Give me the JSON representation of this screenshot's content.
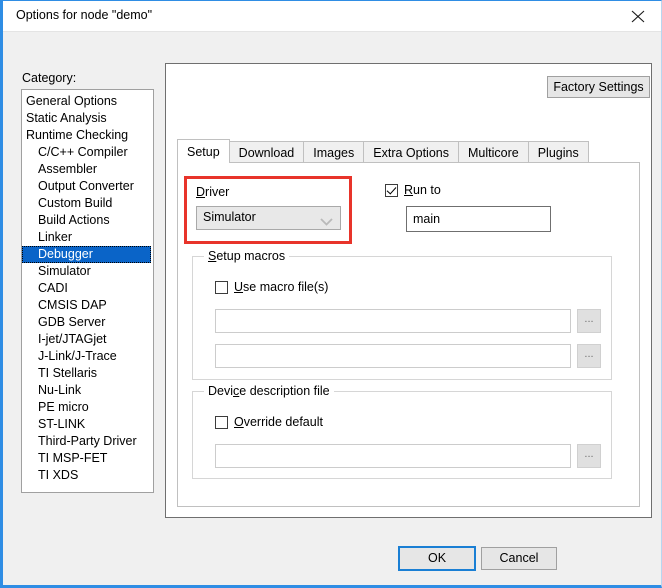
{
  "window": {
    "title": "Options for node \"demo\"",
    "close_icon": "close-icon"
  },
  "sidebar": {
    "label": "Category:",
    "items": [
      {
        "label": "General Options",
        "indent": false,
        "selected": false
      },
      {
        "label": "Static Analysis",
        "indent": false,
        "selected": false
      },
      {
        "label": "Runtime Checking",
        "indent": false,
        "selected": false
      },
      {
        "label": "C/C++ Compiler",
        "indent": true,
        "selected": false
      },
      {
        "label": "Assembler",
        "indent": true,
        "selected": false
      },
      {
        "label": "Output Converter",
        "indent": true,
        "selected": false
      },
      {
        "label": "Custom Build",
        "indent": true,
        "selected": false
      },
      {
        "label": "Build Actions",
        "indent": true,
        "selected": false
      },
      {
        "label": "Linker",
        "indent": true,
        "selected": false
      },
      {
        "label": "Debugger",
        "indent": true,
        "selected": true
      },
      {
        "label": "Simulator",
        "indent": true,
        "selected": false
      },
      {
        "label": "CADI",
        "indent": true,
        "selected": false
      },
      {
        "label": "CMSIS DAP",
        "indent": true,
        "selected": false
      },
      {
        "label": "GDB Server",
        "indent": true,
        "selected": false
      },
      {
        "label": "I-jet/JTAGjet",
        "indent": true,
        "selected": false
      },
      {
        "label": "J-Link/J-Trace",
        "indent": true,
        "selected": false
      },
      {
        "label": "TI Stellaris",
        "indent": true,
        "selected": false
      },
      {
        "label": "Nu-Link",
        "indent": true,
        "selected": false
      },
      {
        "label": "PE micro",
        "indent": true,
        "selected": false
      },
      {
        "label": "ST-LINK",
        "indent": true,
        "selected": false
      },
      {
        "label": "Third-Party Driver",
        "indent": true,
        "selected": false
      },
      {
        "label": "TI MSP-FET",
        "indent": true,
        "selected": false
      },
      {
        "label": "TI XDS",
        "indent": true,
        "selected": false
      }
    ]
  },
  "main": {
    "factory_settings_label": "Factory Settings",
    "tabs": [
      {
        "label": "Setup",
        "active": true
      },
      {
        "label": "Download",
        "active": false
      },
      {
        "label": "Images",
        "active": false
      },
      {
        "label": "Extra Options",
        "active": false
      },
      {
        "label": "Multicore",
        "active": false
      },
      {
        "label": "Plugins",
        "active": false
      }
    ],
    "setup": {
      "driver": {
        "label_prefix": "D",
        "label_rest": "river",
        "selected_value": "Simulator",
        "options": [
          "Simulator"
        ],
        "highlight_color": "#e8342a"
      },
      "run_to": {
        "label_prefix": "R",
        "label_rest": "un to",
        "checked": true,
        "value": "main",
        "placeholder": ""
      },
      "setup_macros": {
        "title_prefix": "S",
        "title_rest": "etup macros",
        "use_macro_files": {
          "label_prefix": "U",
          "label_rest": "se macro file(s)",
          "checked": false
        },
        "files": [
          {
            "value": "",
            "placeholder": "",
            "browse_label": "..."
          },
          {
            "value": "",
            "placeholder": "",
            "browse_label": "..."
          }
        ]
      },
      "device_description": {
        "title_pre": "Devi",
        "title_mid": "c",
        "title_post": "e description file",
        "override_default": {
          "label_prefix": "O",
          "label_rest": "verride default",
          "checked": false
        },
        "file": {
          "value": "",
          "placeholder": "",
          "browse_label": "..."
        }
      }
    }
  },
  "footer": {
    "ok_label": "OK",
    "cancel_label": "Cancel"
  }
}
